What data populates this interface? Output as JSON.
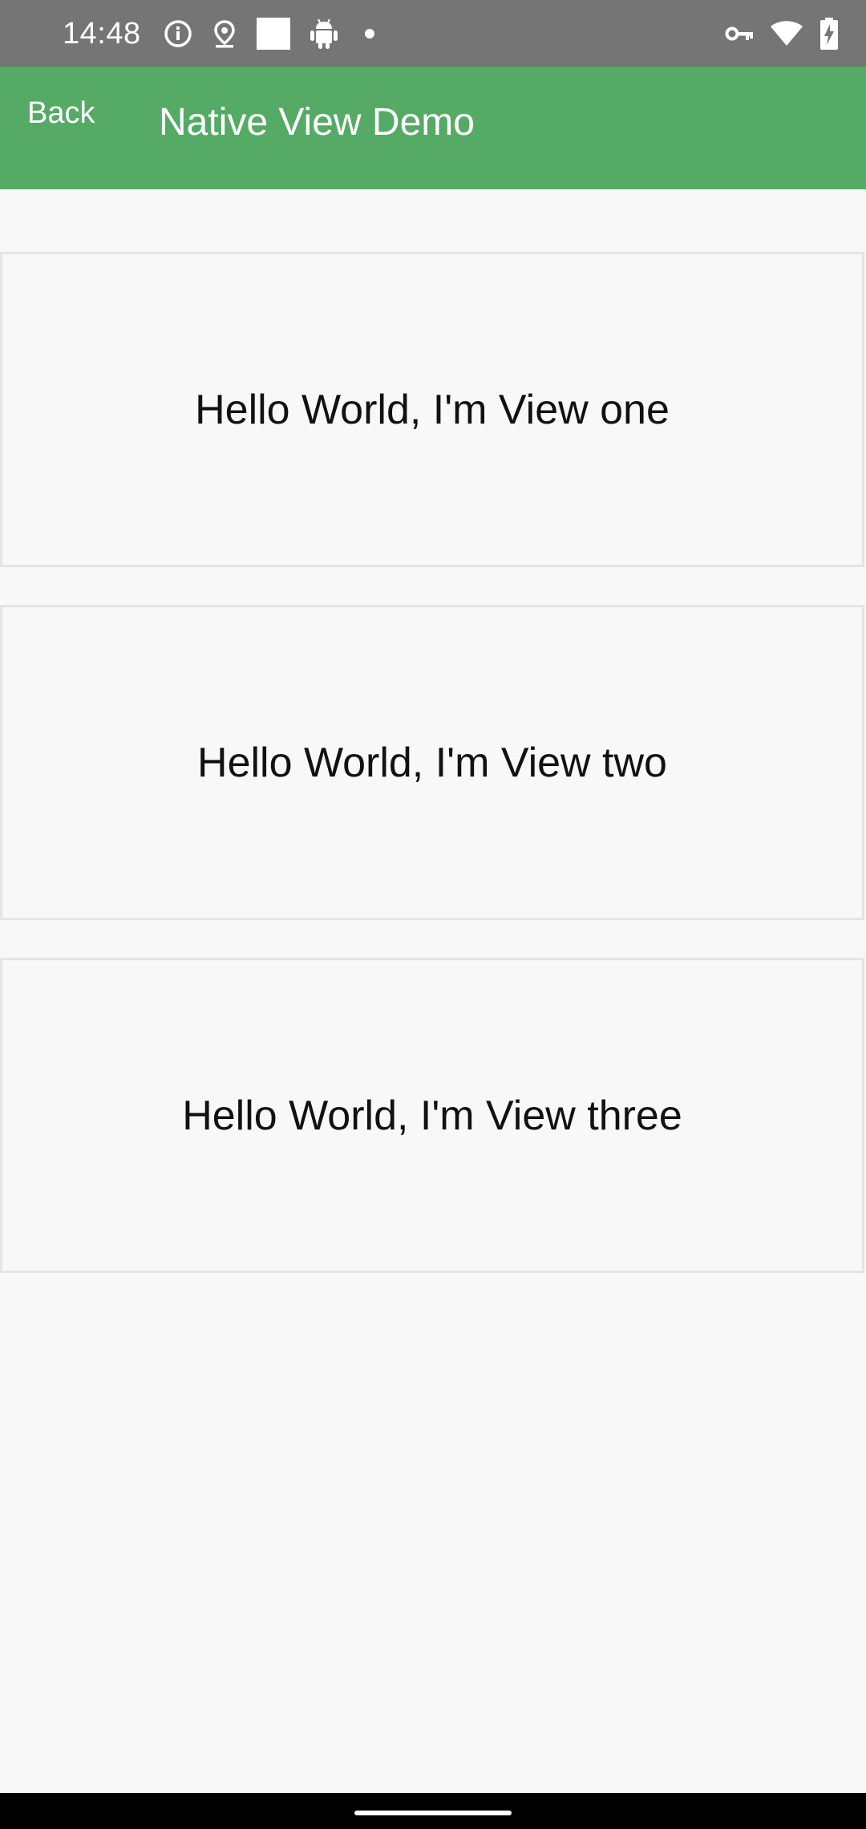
{
  "status_bar": {
    "time": "14:48",
    "left_icons": [
      "info-icon",
      "location-icon",
      "square-icon",
      "android-icon",
      "dot-icon"
    ],
    "right_icons": [
      "vpn-key-icon",
      "wifi-icon",
      "battery-charging-icon"
    ]
  },
  "app_bar": {
    "back_label": "Back",
    "title": "Native View Demo",
    "color": "#55aa65"
  },
  "views": [
    {
      "label": "Hello World, I'm View one"
    },
    {
      "label": "Hello World, I'm View two"
    },
    {
      "label": "Hello World, I'm View three"
    }
  ]
}
